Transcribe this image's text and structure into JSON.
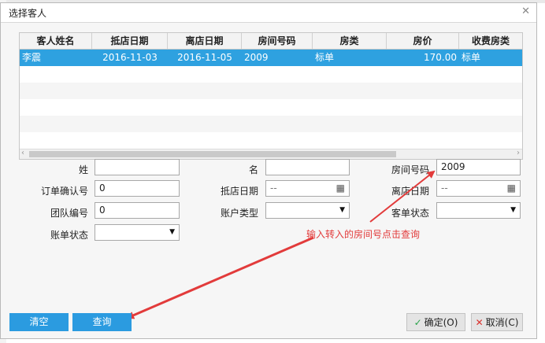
{
  "dialog": {
    "title": "选择客人"
  },
  "grid": {
    "columns": [
      "客人姓名",
      "抵店日期",
      "离店日期",
      "房间号码",
      "房类",
      "房价",
      "收费房类"
    ],
    "rows": [
      {
        "name": "李震",
        "arrival": "2016-11-03",
        "departure": "2016-11-05",
        "room": "2009",
        "room_type": "标单",
        "price": "170.00",
        "charge_type": "标单"
      }
    ]
  },
  "form": {
    "last_name": {
      "label": "姓",
      "value": ""
    },
    "first_name": {
      "label": "名",
      "value": ""
    },
    "room_no": {
      "label": "房间号码",
      "value": "2009"
    },
    "order_no": {
      "label": "订单确认号",
      "value": "0"
    },
    "arrival": {
      "label": "抵店日期",
      "value": "--"
    },
    "departure": {
      "label": "离店日期",
      "value": "--"
    },
    "group_no": {
      "label": "团队编号",
      "value": "0"
    },
    "account_type": {
      "label": "账户类型",
      "value": ""
    },
    "guest_status": {
      "label": "客单状态",
      "value": ""
    },
    "bill_status": {
      "label": "账单状态",
      "value": ""
    }
  },
  "annotation": "输入转入的房间号点击查询",
  "buttons": {
    "clear": "清空",
    "query": "查询",
    "ok": "确定(O)",
    "cancel": "取消(C)"
  },
  "icons": {
    "close": "close-icon",
    "check": "check-icon",
    "cross": "x-icon",
    "calendar": "calendar-icon",
    "dropdown": "chevron-down-icon"
  },
  "colors": {
    "selection": "#2ea1e0",
    "button_primary": "#2b9be0",
    "annotation": "#e23b3b",
    "check": "#2aa34a",
    "cross": "#d9302c"
  }
}
